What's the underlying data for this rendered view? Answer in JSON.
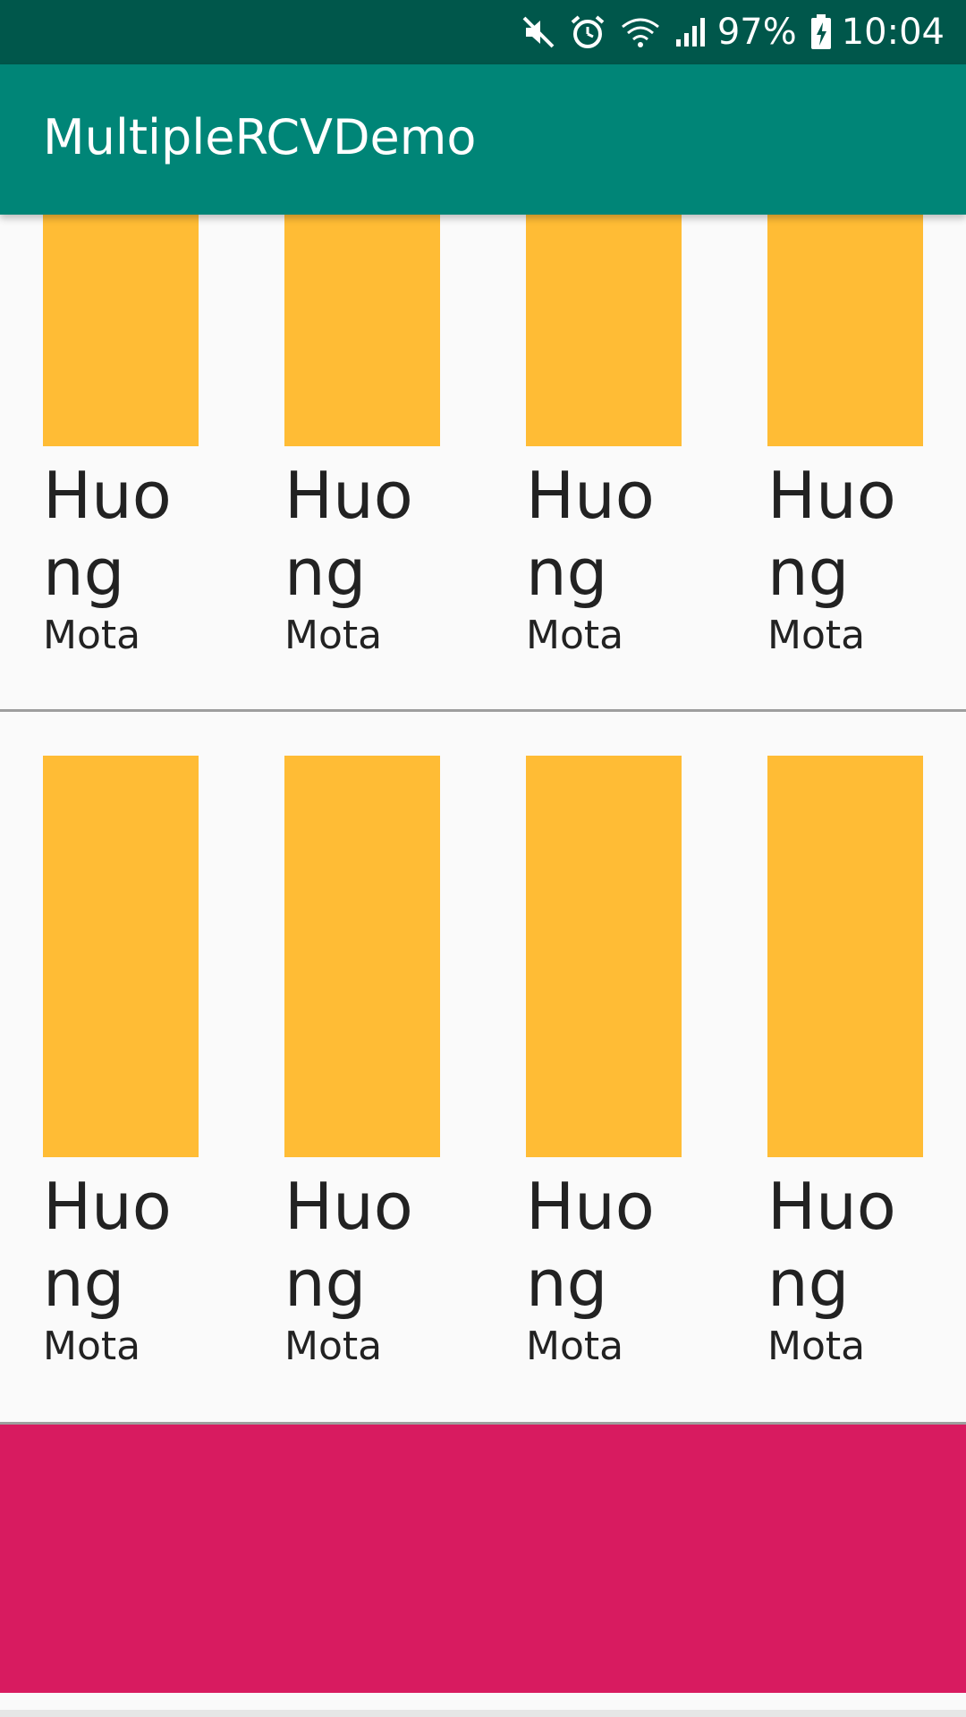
{
  "status_bar": {
    "icons": [
      "mute-icon",
      "alarm-icon",
      "wifi-icon",
      "signal-icon",
      "battery-charging-icon"
    ],
    "battery_percent": "97%",
    "time": "10:04"
  },
  "app_bar": {
    "title": "MultipleRCVDemo"
  },
  "colors": {
    "status_bar": "#00574b",
    "app_bar": "#008577",
    "swatch": "#ffbc35",
    "pink_block": "#d81b60",
    "background": "#fafafa"
  },
  "rows": [
    {
      "items": [
        {
          "title": "Huong",
          "subtitle": "Mota"
        },
        {
          "title": "Huong",
          "subtitle": "Mota"
        },
        {
          "title": "Huong",
          "subtitle": "Mota"
        },
        {
          "title": "Huong",
          "subtitle": "Mota"
        }
      ]
    },
    {
      "items": [
        {
          "title": "Huong",
          "subtitle": "Mota"
        },
        {
          "title": "Huong",
          "subtitle": "Mota"
        },
        {
          "title": "Huong",
          "subtitle": "Mota"
        },
        {
          "title": "Huong",
          "subtitle": "Mota"
        }
      ]
    }
  ]
}
